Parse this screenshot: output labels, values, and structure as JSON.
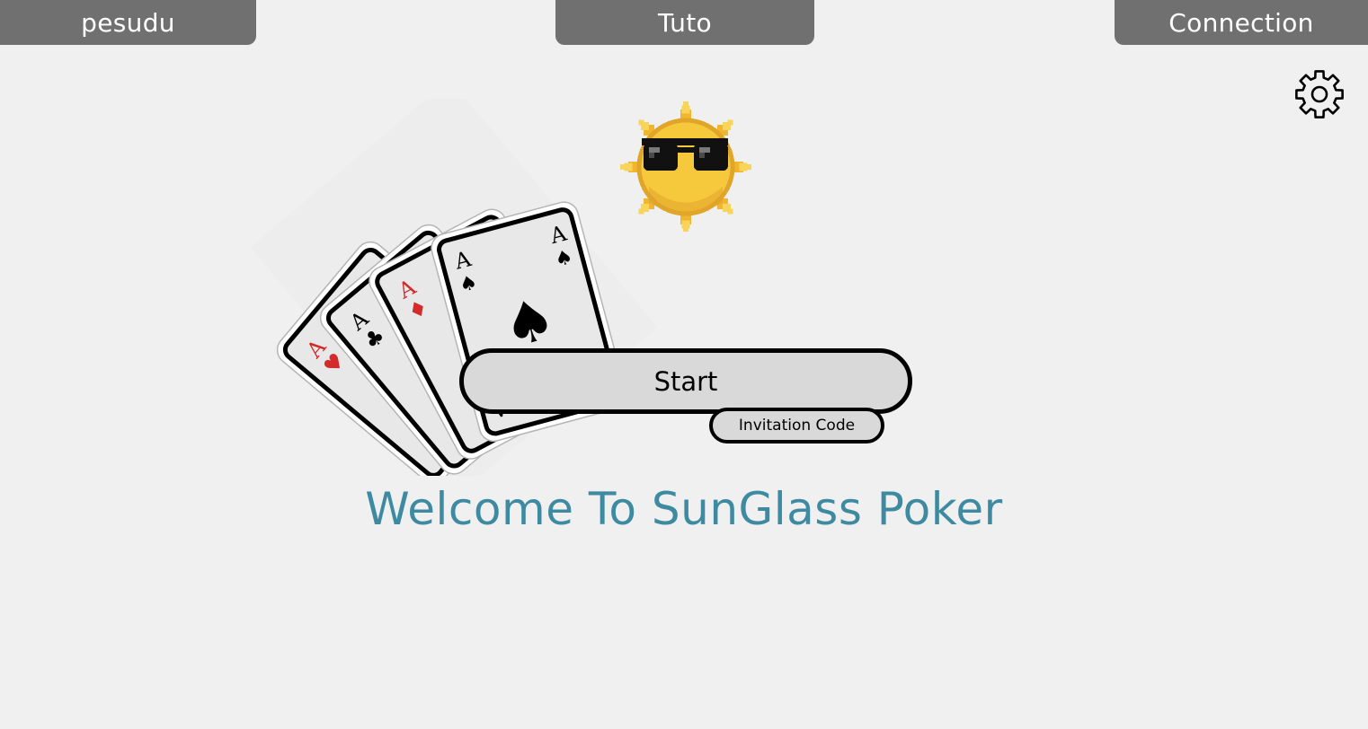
{
  "nav": {
    "left_tab": "pesudu",
    "center_tab": "Tuto",
    "right_tab": "Connection"
  },
  "main": {
    "start_label": "Start",
    "invitation_label": "Invitation Code",
    "welcome_text": "Welcome To SunGlass Poker"
  },
  "icons": {
    "settings": "gear-icon",
    "logo_cards": "four-aces-cards",
    "mascot": "pixel-sun-with-sunglasses"
  },
  "colors": {
    "tab_background": "#707070",
    "tab_text": "#ffffff",
    "page_background": "#f0f0f0",
    "button_background": "#d9d9d9",
    "welcome_text": "#3e8aa0",
    "card_red": "#d32a2a",
    "sun_yellow": "#f5c93a"
  },
  "cards": {
    "rank": "A",
    "suits": [
      "♥",
      "♣",
      "♦",
      "♠"
    ]
  }
}
